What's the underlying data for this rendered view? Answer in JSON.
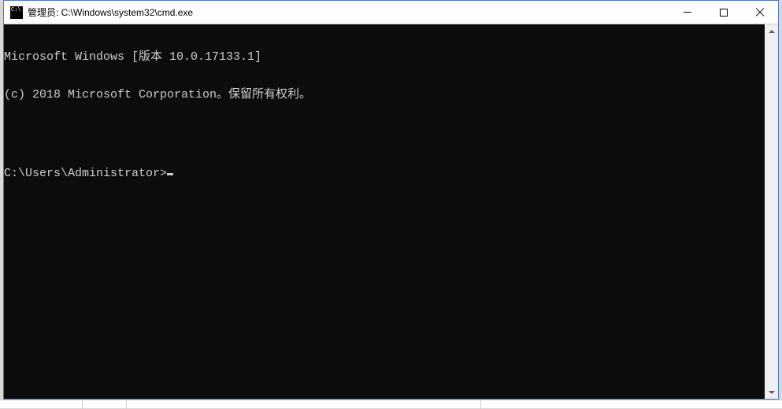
{
  "window": {
    "title": "管理员: C:\\Windows\\system32\\cmd.exe"
  },
  "console": {
    "line1": "Microsoft Windows [版本 10.0.17133.1]",
    "line2": "(c) 2018 Microsoft Corporation。保留所有权利。",
    "blank": "",
    "prompt": "C:\\Users\\Administrator>"
  }
}
